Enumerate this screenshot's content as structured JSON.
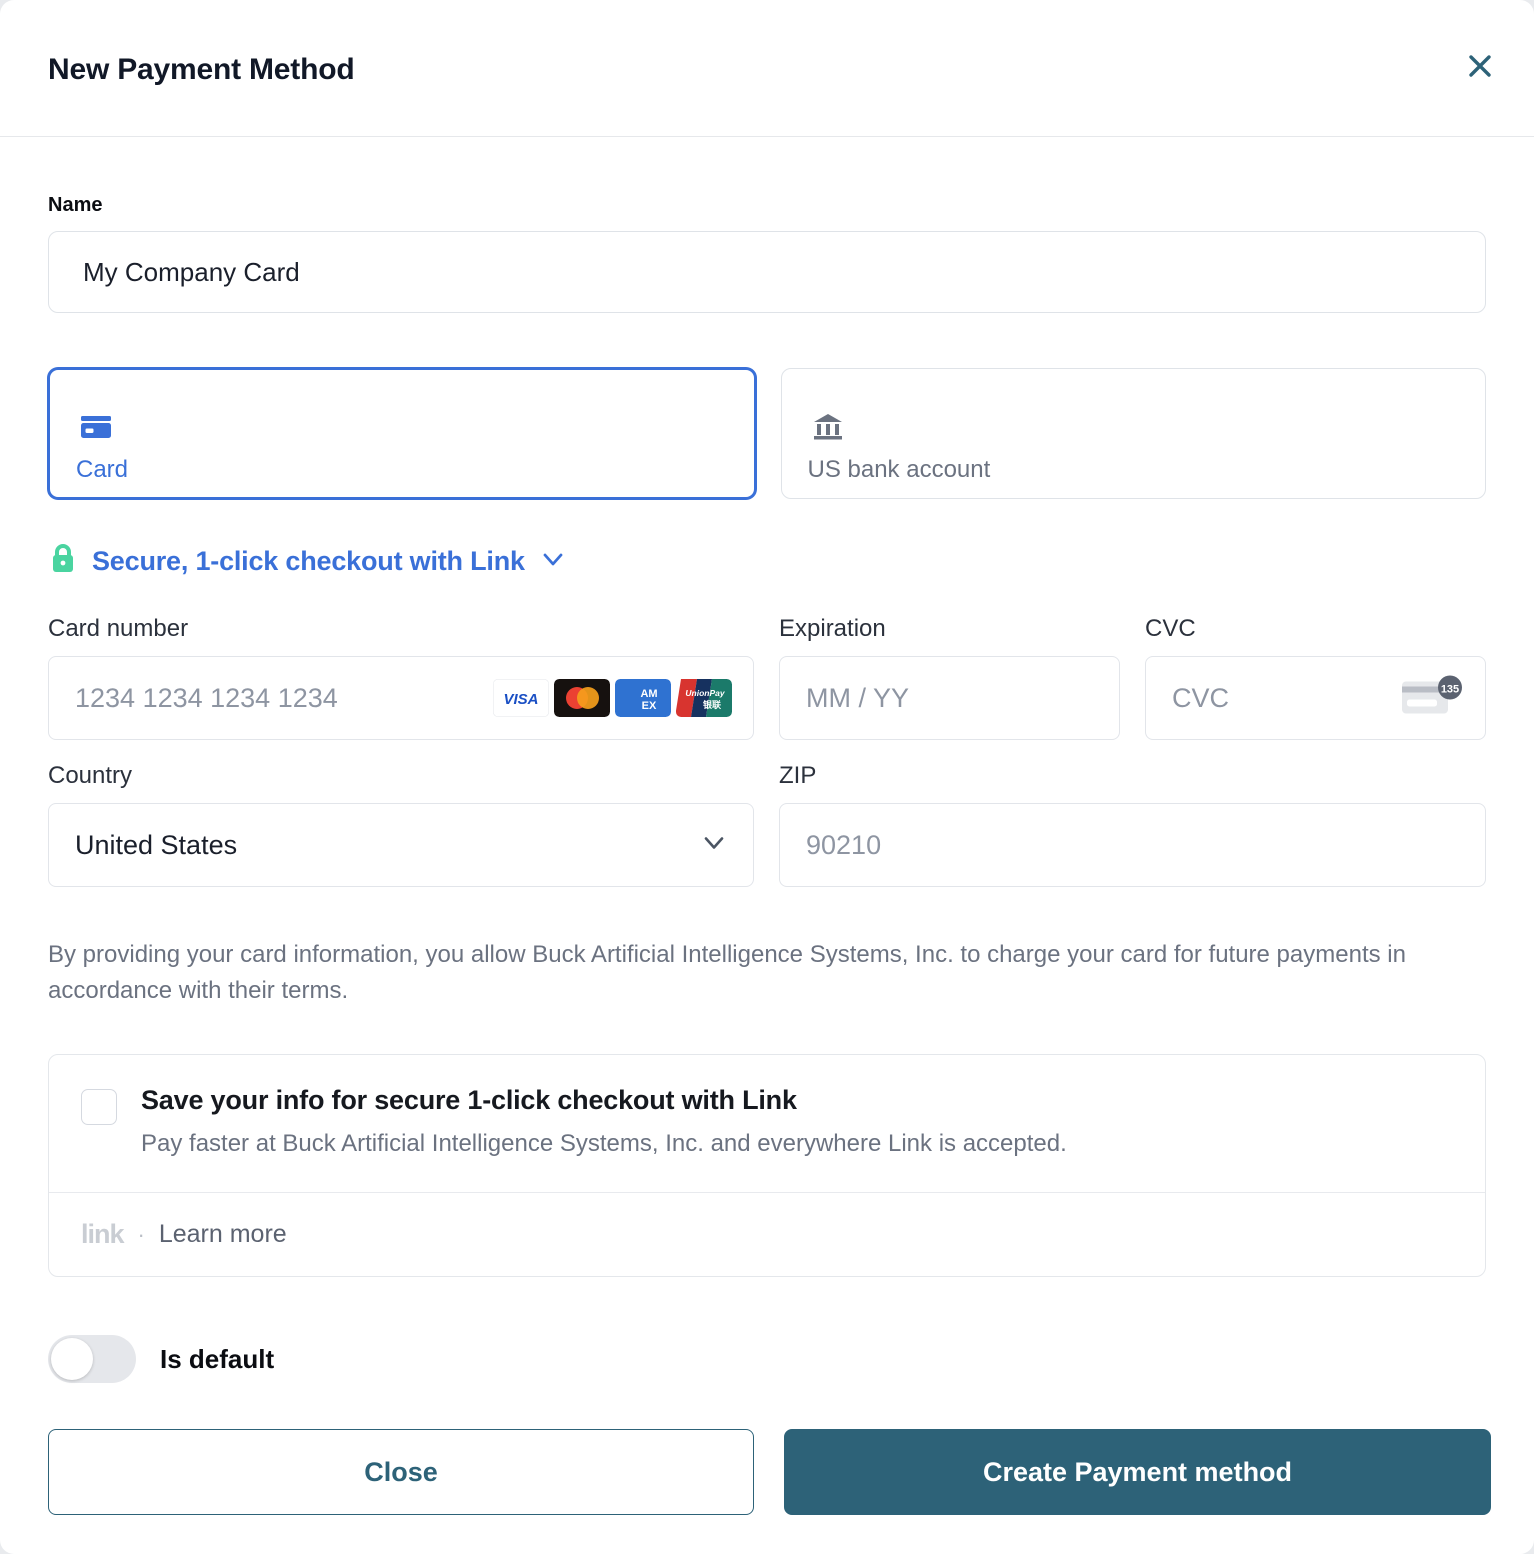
{
  "modal": {
    "title": "New Payment Method",
    "close_icon": "close-icon"
  },
  "name_field": {
    "label": "Name",
    "value": "My Company Card",
    "placeholder": ""
  },
  "payment_types": {
    "selected": "card",
    "options": [
      {
        "id": "card",
        "label": "Card",
        "icon": "credit-card-icon",
        "selected": true
      },
      {
        "id": "us_bank_account",
        "label": "US bank account",
        "icon": "bank-icon",
        "selected": false
      }
    ]
  },
  "link_promo": {
    "lock_icon": "lock-icon",
    "text": "Secure, 1-click checkout with Link",
    "chevron_icon": "chevron-down-icon"
  },
  "card_fields": {
    "card_number": {
      "label": "Card number",
      "placeholder": "1234 1234 1234 1234",
      "value": "",
      "brands": [
        "VISA",
        "Mastercard",
        "AMEX",
        "UnionPay"
      ]
    },
    "expiration": {
      "label": "Expiration",
      "placeholder": "MM / YY",
      "value": ""
    },
    "cvc": {
      "label": "CVC",
      "placeholder": "CVC",
      "value": "",
      "hint_icon": "cvc-card-icon",
      "hint_digits": "135"
    },
    "country": {
      "label": "Country",
      "value": "United States",
      "options": [
        "United States"
      ],
      "chevron_icon": "chevron-down-icon"
    },
    "zip": {
      "label": "ZIP",
      "placeholder": "90210",
      "value": ""
    }
  },
  "disclaimer": "By providing your card information, you allow Buck Artificial Intelligence Systems, Inc. to charge your card for future payments in accordance with their terms.",
  "link_save_box": {
    "checked": false,
    "title": "Save your info for secure 1-click checkout with Link",
    "subtitle": "Pay faster at Buck Artificial Intelligence Systems, Inc. and everywhere Link is accepted.",
    "logo_text": "link",
    "separator": "·",
    "learn_more": "Learn more"
  },
  "is_default": {
    "label": "Is default",
    "enabled": false
  },
  "footer": {
    "close_label": "Close",
    "create_label": "Create Payment method"
  },
  "colors": {
    "accent_teal": "#2d6278",
    "link_blue": "#3a70d8",
    "lock_green": "#4ad4a0",
    "text_dark": "#0b0d12",
    "text_muted": "#6b7280",
    "border": "#dfe3e8"
  }
}
